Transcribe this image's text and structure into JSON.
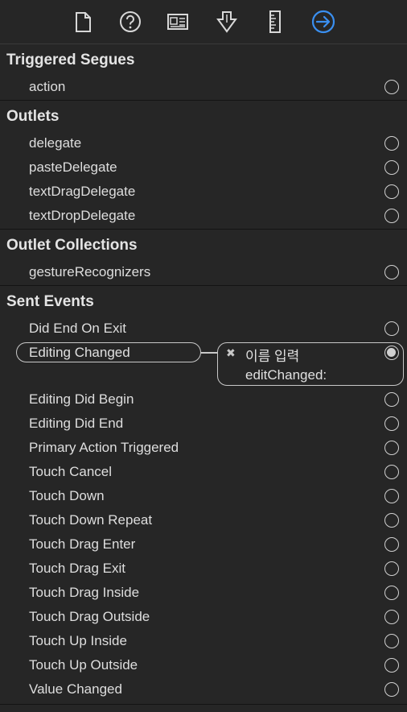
{
  "toolbar": {
    "icons": [
      "file-inspector-icon",
      "help-icon",
      "identity-inspector-icon",
      "attributes-inspector-icon",
      "size-inspector-icon",
      "connections-inspector-icon"
    ],
    "active": "connections-inspector-icon",
    "accent_color": "#3a8ff0"
  },
  "sections": {
    "triggered_segues": {
      "title": "Triggered Segues",
      "items": [
        "action"
      ]
    },
    "outlets": {
      "title": "Outlets",
      "items": [
        "delegate",
        "pasteDelegate",
        "textDragDelegate",
        "textDropDelegate"
      ]
    },
    "outlet_collections": {
      "title": "Outlet Collections",
      "items": [
        "gestureRecognizers"
      ]
    },
    "sent_events": {
      "title": "Sent Events",
      "items": [
        "Did End On Exit",
        "Editing Changed",
        "Editing Did Begin",
        "Editing Did End",
        "Primary Action Triggered",
        "Touch Cancel",
        "Touch Down",
        "Touch Down Repeat",
        "Touch Drag Enter",
        "Touch Drag Exit",
        "Touch Drag Inside",
        "Touch Drag Outside",
        "Touch Up Inside",
        "Touch Up Outside",
        "Value Changed"
      ]
    }
  },
  "connection": {
    "event": "Editing Changed",
    "remove_glyph": "✖",
    "target": "이름 입력",
    "action": "editChanged:"
  }
}
